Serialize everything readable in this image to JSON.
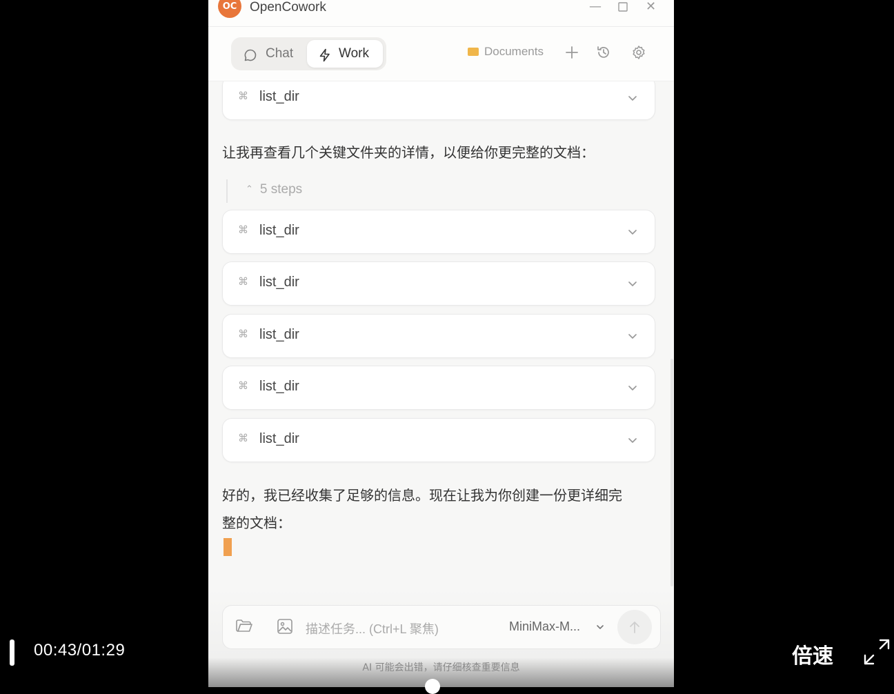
{
  "window": {
    "title": "OpenCowork",
    "logo_text": "OC"
  },
  "header": {
    "tabs": [
      {
        "label": "Chat"
      },
      {
        "label": "Work"
      }
    ],
    "folder_label": "Documents"
  },
  "conversation": {
    "tool_calls": [
      {
        "name": "list_dir"
      },
      {
        "name": "list_dir"
      },
      {
        "name": "list_dir"
      },
      {
        "name": "list_dir"
      },
      {
        "name": "list_dir"
      },
      {
        "name": "list_dir"
      }
    ],
    "message_1": "让我再查看几个关键文件夹的详情，以便给你更完整的文档：",
    "steps_label": "5 steps",
    "message_2_line1": "好的，我已经收集了足够的信息。现在让我为你创建一份更详细完",
    "message_2_line2": "整的文档："
  },
  "input": {
    "placeholder": "描述任务... (Ctrl+L 聚焦)",
    "model": "MiniMax-M...",
    "disclaimer": "AI 可能会出错，请仔细核查重要信息"
  },
  "player": {
    "time": "00:43/01:29",
    "speed_label": "倍速"
  },
  "colors": {
    "accent": "#e8763a",
    "cursor": "#f0a050",
    "folder": "#f0b64a"
  }
}
